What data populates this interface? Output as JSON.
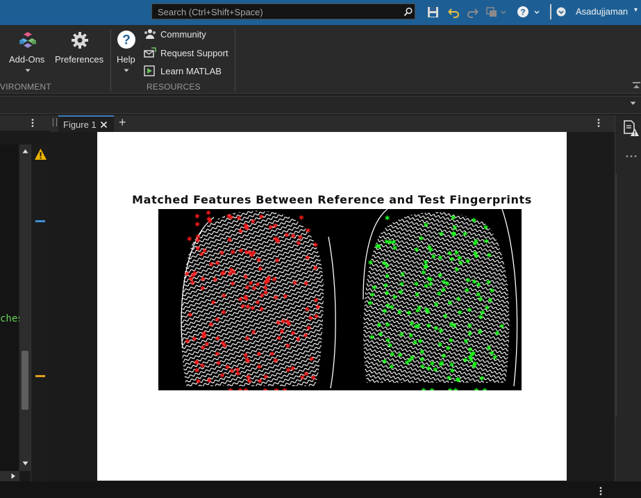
{
  "search": {
    "placeholder": "Search (Ctrl+Shift+Space)"
  },
  "user": {
    "name": "Asadujjaman"
  },
  "ribbon": {
    "addons_label": "Add-Ons",
    "preferences_label": "Preferences",
    "help_label": "Help",
    "community_label": "Community",
    "request_support_label": "Request Support",
    "learn_matlab_label": "Learn MATLAB",
    "environment_section": "VIRONMENT",
    "resources_section": "RESOURCES"
  },
  "editor": {
    "visible_text": "ches"
  },
  "figure_tab": {
    "label": "Figure 1",
    "add_label": "+"
  },
  "figure": {
    "title": "Matched Features Between Reference and Test Fingerprints"
  },
  "colors": {
    "titlebar": "#1d5f95",
    "match_reference": "#ff0000",
    "match_test": "#00ff00",
    "warning": "#f0b400",
    "marker_blue": "#3d8fd6",
    "marker_orange": "#e0a020",
    "editor_text": "#67d35a"
  },
  "icons": {
    "search": "search-icon",
    "save": "save-icon",
    "undo": "undo-icon",
    "redo": "redo-icon",
    "layout": "window-layout-icon",
    "help": "help-icon",
    "warning": "warning-icon"
  }
}
